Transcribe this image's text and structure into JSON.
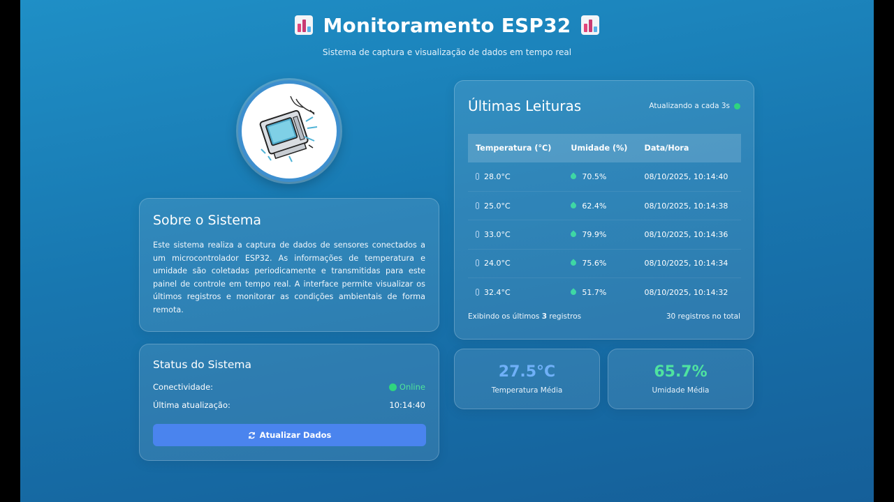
{
  "header": {
    "title": "Monitoramento ESP32",
    "subtitle": "Sistema de captura e visualização de dados em tempo real",
    "emoji_icon": "bar-chart-icon"
  },
  "about": {
    "title": "Sobre o Sistema",
    "text": "Este sistema realiza a captura de dados de sensores conectados a um microcontrolador ESP32. As informações de temperatura e umidade são coletadas periodicamente e transmitidas para este painel de controle em tempo real. A interface permite visualizar os últimos registros e monitorar as condições ambientais de forma remota."
  },
  "status": {
    "title": "Status do Sistema",
    "connectivity_label": "Conectividade:",
    "connectivity_value": "Online",
    "last_update_label": "Última atualização:",
    "last_update_value": "10:14:40",
    "refresh_button": "Atualizar Dados",
    "refresh_icon": "sync-icon"
  },
  "readings": {
    "title": "Últimas Leituras",
    "refresh_note": "Atualizando a cada 3s",
    "columns": [
      "Temperatura (°C)",
      "Umidade (%)",
      "Data/Hora"
    ],
    "rows": [
      {
        "temp": "28.0°C",
        "hum": "70.5%",
        "datetime": "08/10/2025, 10:14:40"
      },
      {
        "temp": "25.0°C",
        "hum": "62.4%",
        "datetime": "08/10/2025, 10:14:38"
      },
      {
        "temp": "33.0°C",
        "hum": "79.9%",
        "datetime": "08/10/2025, 10:14:36"
      },
      {
        "temp": "24.0°C",
        "hum": "75.6%",
        "datetime": "08/10/2025, 10:14:34"
      },
      {
        "temp": "32.4°C",
        "hum": "51.7%",
        "datetime": "08/10/2025, 10:14:32"
      }
    ],
    "footer_prefix": "Exibindo os últimos",
    "footer_count": "3",
    "footer_suffix": "registros",
    "total": "30 registros no total"
  },
  "stats": {
    "temp_value": "27.5°C",
    "temp_label": "Temperatura Média",
    "hum_value": "65.7%",
    "hum_label": "Umidade Média"
  },
  "colors": {
    "background": "#1877b0",
    "accent_button": "#4a84ee",
    "online": "#2fd57f",
    "temp_stat": "#6fb0f8",
    "hum_stat": "#4fe3a0"
  }
}
